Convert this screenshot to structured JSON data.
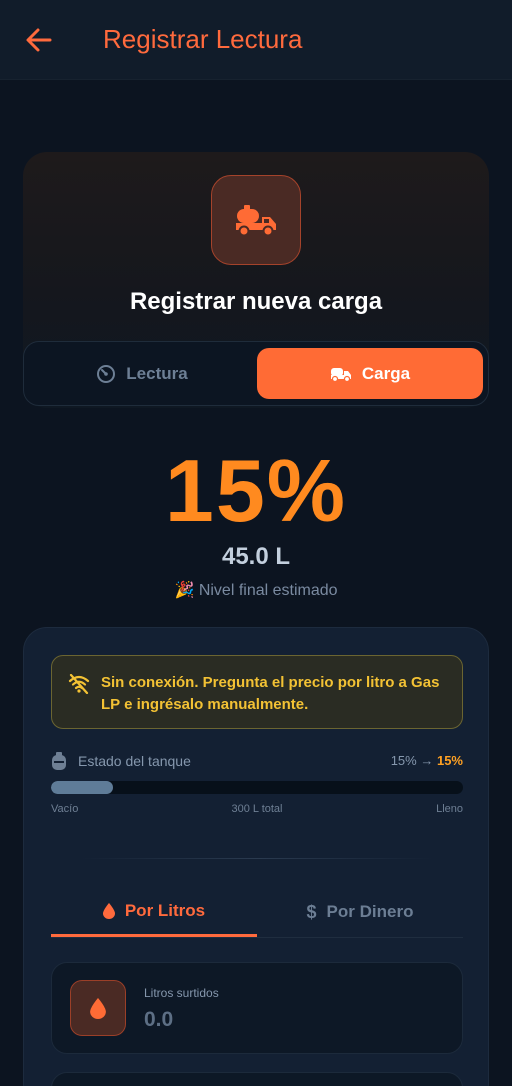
{
  "appbar": {
    "title": "Registrar Lectura"
  },
  "hero": {
    "title": "Registrar nueva carga",
    "icon": "tank-truck-icon"
  },
  "mode_toggle": {
    "options": [
      {
        "label": "Lectura",
        "icon": "gauge-icon",
        "selected": false
      },
      {
        "label": "Carga",
        "icon": "truck-icon",
        "selected": true
      }
    ]
  },
  "estimate": {
    "percent": "15%",
    "liters": "45.0 L",
    "caption": "🎉 Nivel final estimado"
  },
  "warning": {
    "text": "Sin conexión. Pregunta el precio por litro a Gas LP e ingrésalo manualmente.",
    "icon": "wifi-off-icon"
  },
  "tank": {
    "label": "Estado del tanque",
    "from": "15%",
    "arrow": "→",
    "to": "15%",
    "fill_fraction": 0.15,
    "min_label": "Vacío",
    "total_label": "300 L total",
    "max_label": "Lleno"
  },
  "tabs": [
    {
      "label": "Por Litros",
      "icon": "drop-icon",
      "active": true
    },
    {
      "label": "Por Dinero",
      "icon": "dollar-icon",
      "active": false
    }
  ],
  "liters_input": {
    "label": "Litros surtidos",
    "value": "0.0"
  },
  "colors": {
    "accent": "#ff6b35",
    "percent": "#ff8a1f",
    "warning": "#f3c234",
    "background": "#0c1420"
  }
}
